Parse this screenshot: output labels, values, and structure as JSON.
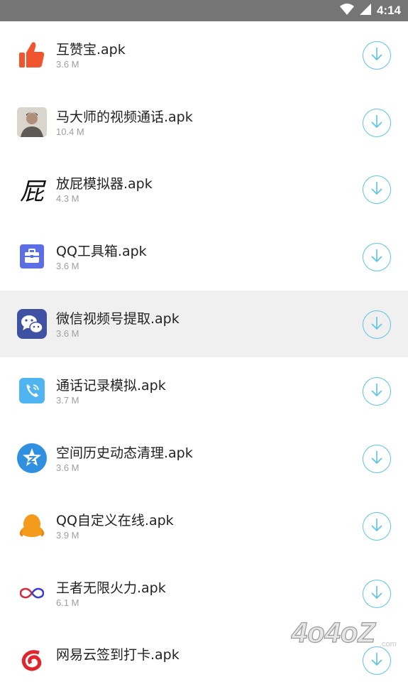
{
  "status_bar": {
    "time": "4:14"
  },
  "apps": [
    {
      "name": "互赞宝.apk",
      "size": "3.6 M",
      "icon": "thumbs-up-icon"
    },
    {
      "name": "马大师的视频通话.apk",
      "size": "10.4 M",
      "icon": "portrait-icon"
    },
    {
      "name": "放屁模拟器.apk",
      "size": "4.3 M",
      "icon": "calligraphy-icon",
      "icon_char": "屁"
    },
    {
      "name": "QQ工具箱.apk",
      "size": "3.6 M",
      "icon": "toolbox-icon"
    },
    {
      "name": "微信视频号提取.apk",
      "size": "3.6 M",
      "icon": "wechat-icon",
      "highlighted": true
    },
    {
      "name": "通话记录模拟.apk",
      "size": "3.7 M",
      "icon": "phone-icon"
    },
    {
      "name": "空间历史动态清理.apk",
      "size": "3.6 M",
      "icon": "qzone-star-icon"
    },
    {
      "name": "QQ自定义在线.apk",
      "size": "3.9 M",
      "icon": "penguin-icon"
    },
    {
      "name": "王者无限火力.apk",
      "size": "6.1 M",
      "icon": "infinity-icon"
    },
    {
      "name": "网易云签到打卡.apk",
      "size": "",
      "icon": "netease-icon"
    }
  ],
  "watermark": {
    "text": "4o4oZ",
    "suffix": ".com"
  },
  "colors": {
    "status_bar": "#757575",
    "download_accent": "#5bc3e6",
    "highlight_row": "#f0f0f0"
  }
}
